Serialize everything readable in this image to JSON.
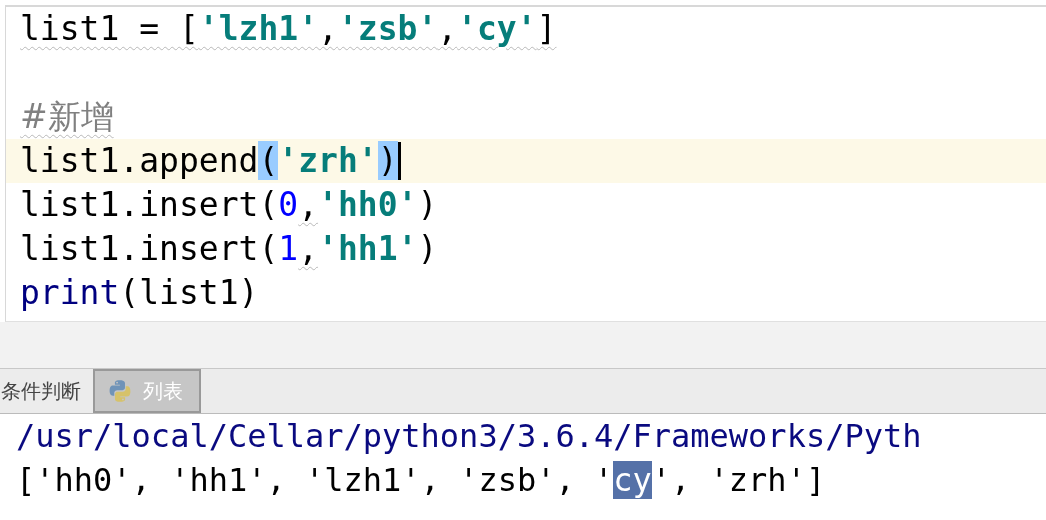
{
  "editor": {
    "lines": [
      {
        "current": false,
        "tokens": [
          {
            "kind": "plain",
            "text": "list1 = [",
            "warning": true,
            "matched": false
          },
          {
            "kind": "string",
            "text": "'lzh1'",
            "warning": true,
            "matched": false
          },
          {
            "kind": "plain",
            "text": ",",
            "warning": true,
            "matched": false
          },
          {
            "kind": "string",
            "text": "'zsb'",
            "warning": true,
            "matched": false
          },
          {
            "kind": "plain",
            "text": ",",
            "warning": true,
            "matched": false
          },
          {
            "kind": "string",
            "text": "'cy'",
            "warning": true,
            "matched": false
          },
          {
            "kind": "plain",
            "text": "]",
            "warning": true,
            "matched": false
          }
        ]
      },
      {
        "current": false
      },
      {
        "current": false,
        "tokens": [
          {
            "kind": "comment",
            "text": "#新增",
            "warning": true,
            "matched": false
          }
        ]
      },
      {
        "current": true,
        "caret": true,
        "tokens": [
          {
            "kind": "plain",
            "text": "list1.append",
            "warning": false,
            "matched": false
          },
          {
            "kind": "plain",
            "text": "(",
            "warning": false,
            "matched": true
          },
          {
            "kind": "string",
            "text": "'zrh'",
            "warning": false,
            "matched": false
          },
          {
            "kind": "plain",
            "text": ")",
            "warning": false,
            "matched": true
          }
        ]
      },
      {
        "current": false,
        "tokens": [
          {
            "kind": "plain",
            "text": "list1.insert(",
            "warning": false,
            "matched": false
          },
          {
            "kind": "number",
            "text": "0",
            "warning": false,
            "matched": false
          },
          {
            "kind": "plain",
            "text": ",",
            "warning": true,
            "matched": false
          },
          {
            "kind": "string",
            "text": "'hh0'",
            "warning": false,
            "matched": false
          },
          {
            "kind": "plain",
            "text": ")",
            "warning": false,
            "matched": false
          }
        ]
      },
      {
        "current": false,
        "tokens": [
          {
            "kind": "plain",
            "text": "list1.insert(",
            "warning": false,
            "matched": false
          },
          {
            "kind": "number",
            "text": "1",
            "warning": false,
            "matched": false
          },
          {
            "kind": "plain",
            "text": ",",
            "warning": true,
            "matched": false
          },
          {
            "kind": "string",
            "text": "'hh1'",
            "warning": false,
            "matched": false
          },
          {
            "kind": "plain",
            "text": ")",
            "warning": false,
            "matched": false
          }
        ]
      },
      {
        "current": false,
        "tokens": [
          {
            "kind": "keyword",
            "text": "print",
            "warning": false,
            "matched": false
          },
          {
            "kind": "plain",
            "text": "(list1)",
            "warning": false,
            "matched": false
          }
        ]
      }
    ]
  },
  "run_tabs": [
    {
      "kind": "text",
      "label": "条件判断",
      "selected": false
    },
    {
      "kind": "python",
      "label": "列表",
      "selected": true
    }
  ],
  "console": {
    "lines": [
      {
        "kind": "path",
        "parts": [
          {
            "text": "/usr/local/Cellar/python3/3.6.4/Frameworks/Pyth",
            "selected": false
          }
        ]
      },
      {
        "kind": "output",
        "parts": [
          {
            "text": "['hh0', 'hh1', 'lzh1', 'zsb', '",
            "selected": false
          },
          {
            "text": "cy",
            "selected": true
          },
          {
            "text": "', 'zrh']",
            "selected": false
          }
        ]
      }
    ]
  }
}
